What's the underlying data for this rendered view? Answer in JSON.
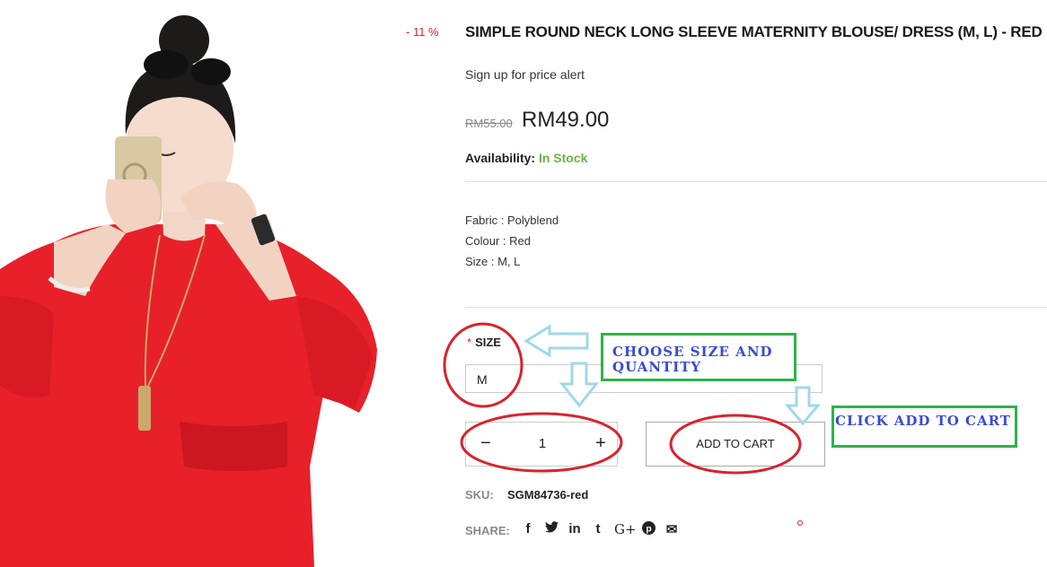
{
  "product": {
    "discount_badge": "- 11 %",
    "title": "SIMPLE ROUND NECK LONG SLEEVE MATERNITY BLOUSE/ DRESS (M, L) - RED",
    "price_alert_link": "Sign up for price alert",
    "old_price": "RM55.00",
    "new_price": "RM49.00",
    "availability_label": "Availability:",
    "availability_value": "In Stock",
    "description": {
      "fabric": "Fabric : Polyblend",
      "colour": "Colour : Red",
      "size": "Size : M, L"
    }
  },
  "options": {
    "size_required_mark": "*",
    "size_label": "SIZE",
    "size_selected": "M"
  },
  "quantity": {
    "minus": "−",
    "value": "1",
    "plus": "+"
  },
  "add_to_cart_label": "ADD TO CART",
  "sku": {
    "label": "SKU:",
    "value": "SGM84736-red"
  },
  "share": {
    "label": "SHARE:",
    "icons": [
      {
        "name": "facebook-icon",
        "glyph": "f"
      },
      {
        "name": "twitter-icon",
        "glyph": "🐦"
      },
      {
        "name": "linkedin-icon",
        "glyph": "in"
      },
      {
        "name": "tumblr-icon",
        "glyph": "t"
      },
      {
        "name": "google-plus-icon",
        "glyph": "G+"
      },
      {
        "name": "pinterest-icon",
        "glyph": "P"
      },
      {
        "name": "email-icon",
        "glyph": "✉"
      }
    ]
  },
  "annotations": {
    "choose_size_quantity": "CHOOSE SIZE AND QUANTITY",
    "click_add_to_cart": "CLICK ADD TO CART"
  },
  "colors": {
    "dress_red": "#e8202a",
    "in_stock_green": "#6db33f",
    "annotation_red": "#d9232d",
    "annotation_blue_arrow": "#9fd8ea",
    "annotation_green_box": "#2db34a",
    "annotation_text": "#3a4bd1"
  }
}
